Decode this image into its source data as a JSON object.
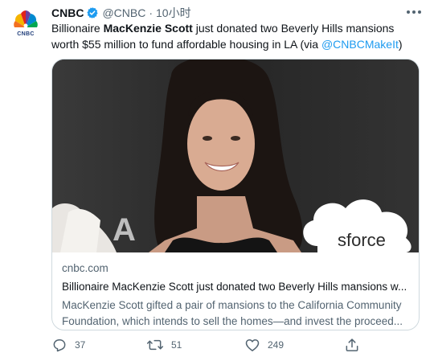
{
  "account": {
    "logo_text": "CNBC",
    "name": "CNBC",
    "handle": "@CNBC",
    "separator": "·",
    "time": "10小时",
    "verified": true
  },
  "tweet": {
    "text_before": "Billionaire ",
    "text_bold": "MacKenzie Scott",
    "text_after": " just donated two Beverly Hills mansions worth $55 million to fund affordable housing in LA (via ",
    "mention": "@CNBCMakeIt",
    "text_end": ")"
  },
  "card": {
    "backdrop_text": "sforce",
    "domain": "cnbc.com",
    "title": "Billionaire MacKenzie Scott just donated two Beverly Hills mansions w...",
    "description": "MacKenzie Scott gifted a pair of mansions to the California Community Foundation, which intends to sell the homes—and invest the proceed..."
  },
  "actions": {
    "reply_count": "37",
    "retweet_count": "51",
    "like_count": "249"
  },
  "colors": {
    "text": "#0f1419",
    "secondary": "#536471",
    "link": "#1d9bf0",
    "verified": "#1d9bf0",
    "border": "#cfd9de"
  },
  "icons": [
    "peacock-logo-icon",
    "verified-badge-icon",
    "more-icon",
    "reply-icon",
    "retweet-icon",
    "like-icon",
    "share-icon"
  ]
}
